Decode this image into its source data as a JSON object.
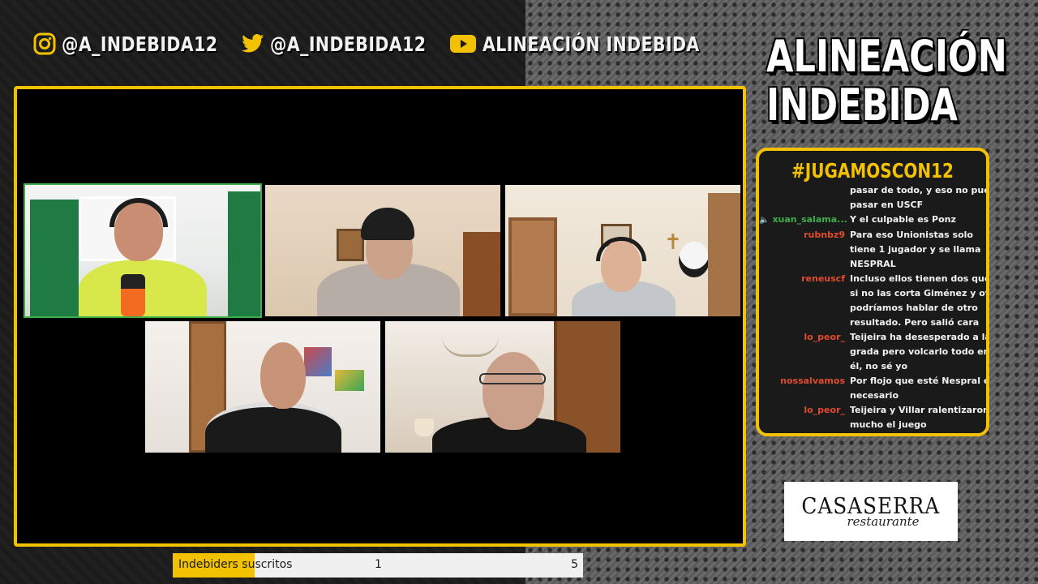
{
  "social": {
    "instagram": "@A_INDEBIDA12",
    "twitter": "@A_INDEBIDA12",
    "youtube": "ALINEACIÓN INDEBIDA"
  },
  "brand": {
    "line1": "ALINEACIÓN",
    "line2": "INDEBIDA"
  },
  "chat": {
    "hashtag": "#JUGAMOSCON12",
    "messages": [
      {
        "user": "",
        "lines": [
          "pasar de todo, y eso no puede",
          "pasar en USCF"
        ],
        "user_color": "#e04b2d"
      },
      {
        "user": "xuan_salama...",
        "lines": [
          "Y el culpable es Ponz"
        ],
        "user_color": "#3fae49",
        "speaker": true
      },
      {
        "user": "rubnbz9",
        "lines": [
          "Para eso Unionistas solo",
          "tiene 1 jugador y se llama",
          "NESPRAL"
        ],
        "user_color": "#e04b2d"
      },
      {
        "user": "reneuscf",
        "lines": [
          "Incluso ellos tienen dos que",
          "si no las corta Giménez y otro",
          "podríamos hablar de otro",
          "resultado. Pero salió cara"
        ],
        "user_color": "#e04b2d"
      },
      {
        "user": "lo_peor_",
        "lines": [
          "Teijeira ha desesperado a la",
          "grada pero volcarlo todo en",
          "él, no sé yo"
        ],
        "user_color": "#e04b2d"
      },
      {
        "user": "nossalvamos",
        "lines": [
          "Por flojo que esté Nespral es",
          "necesario"
        ],
        "user_color": "#e04b2d"
      },
      {
        "user": "lo_peor_",
        "lines": [
          "Teijeira y Villar ralentizaron",
          "mucho el juego"
        ],
        "user_color": "#e04b2d"
      }
    ]
  },
  "sponsor": {
    "name": "CASASERRA",
    "sub": "restaurante"
  },
  "subscribers": {
    "label": "Indebiders suscritos",
    "current": "1",
    "goal": "5",
    "progress": 0.2
  },
  "colors": {
    "accent": "#f2c200",
    "active_speaker": "#3fae49"
  }
}
